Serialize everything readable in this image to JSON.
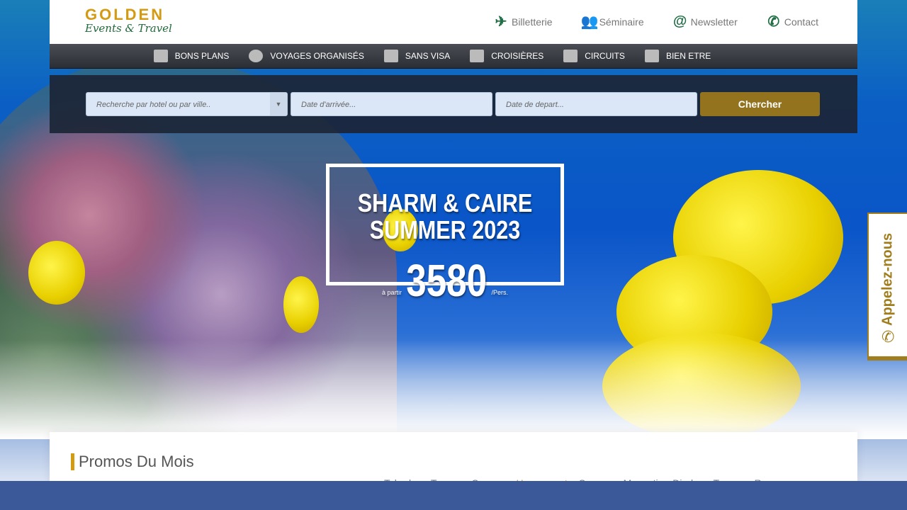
{
  "logo": {
    "brand": "GOLDEN",
    "tagline": "Events & Travel"
  },
  "top_links": [
    {
      "label": "Billetterie",
      "icon": "plane-icon"
    },
    {
      "label": "Séminaire",
      "icon": "group-icon"
    },
    {
      "label": "Newsletter",
      "icon": "at-icon"
    },
    {
      "label": "Contact",
      "icon": "phone-icon"
    }
  ],
  "nav": [
    {
      "label": "BONS PLANS",
      "icon": "hotel-icon"
    },
    {
      "label": "VOYAGES ORGANISÉS",
      "icon": "group-icon"
    },
    {
      "label": "SANS VISA",
      "icon": "luggage-cart-icon"
    },
    {
      "label": "CROISIÈRES",
      "icon": "ship-icon"
    },
    {
      "label": "CIRCUITS",
      "icon": "map-icon"
    },
    {
      "label": "BIEN ETRE",
      "icon": "spa-icon"
    }
  ],
  "search": {
    "hotel_placeholder": "Recherche par hotel ou par ville..",
    "arrival_placeholder": "Date d'arrivée...",
    "departure_placeholder": "Date de depart...",
    "button": "Chercher"
  },
  "banner": {
    "line1": "SHARM & CAIRE",
    "line2": "SUMMER 2023",
    "from": "à partir",
    "price": "3580",
    "unit": "/Pers."
  },
  "promos": {
    "title": "Promos Du Mois",
    "tabs": [
      "Tabarka",
      "Tozeur",
      "Sousse",
      "Hammamet",
      "Sousse",
      "Monastir",
      "Djerba",
      "Tozeur",
      "R"
    ]
  },
  "call_tab": {
    "label": "Appelez-nous"
  },
  "colors": {
    "gold": "#d39a12",
    "button": "#93731d",
    "green": "#1f6e45",
    "footer_bar": "#3b5998"
  }
}
